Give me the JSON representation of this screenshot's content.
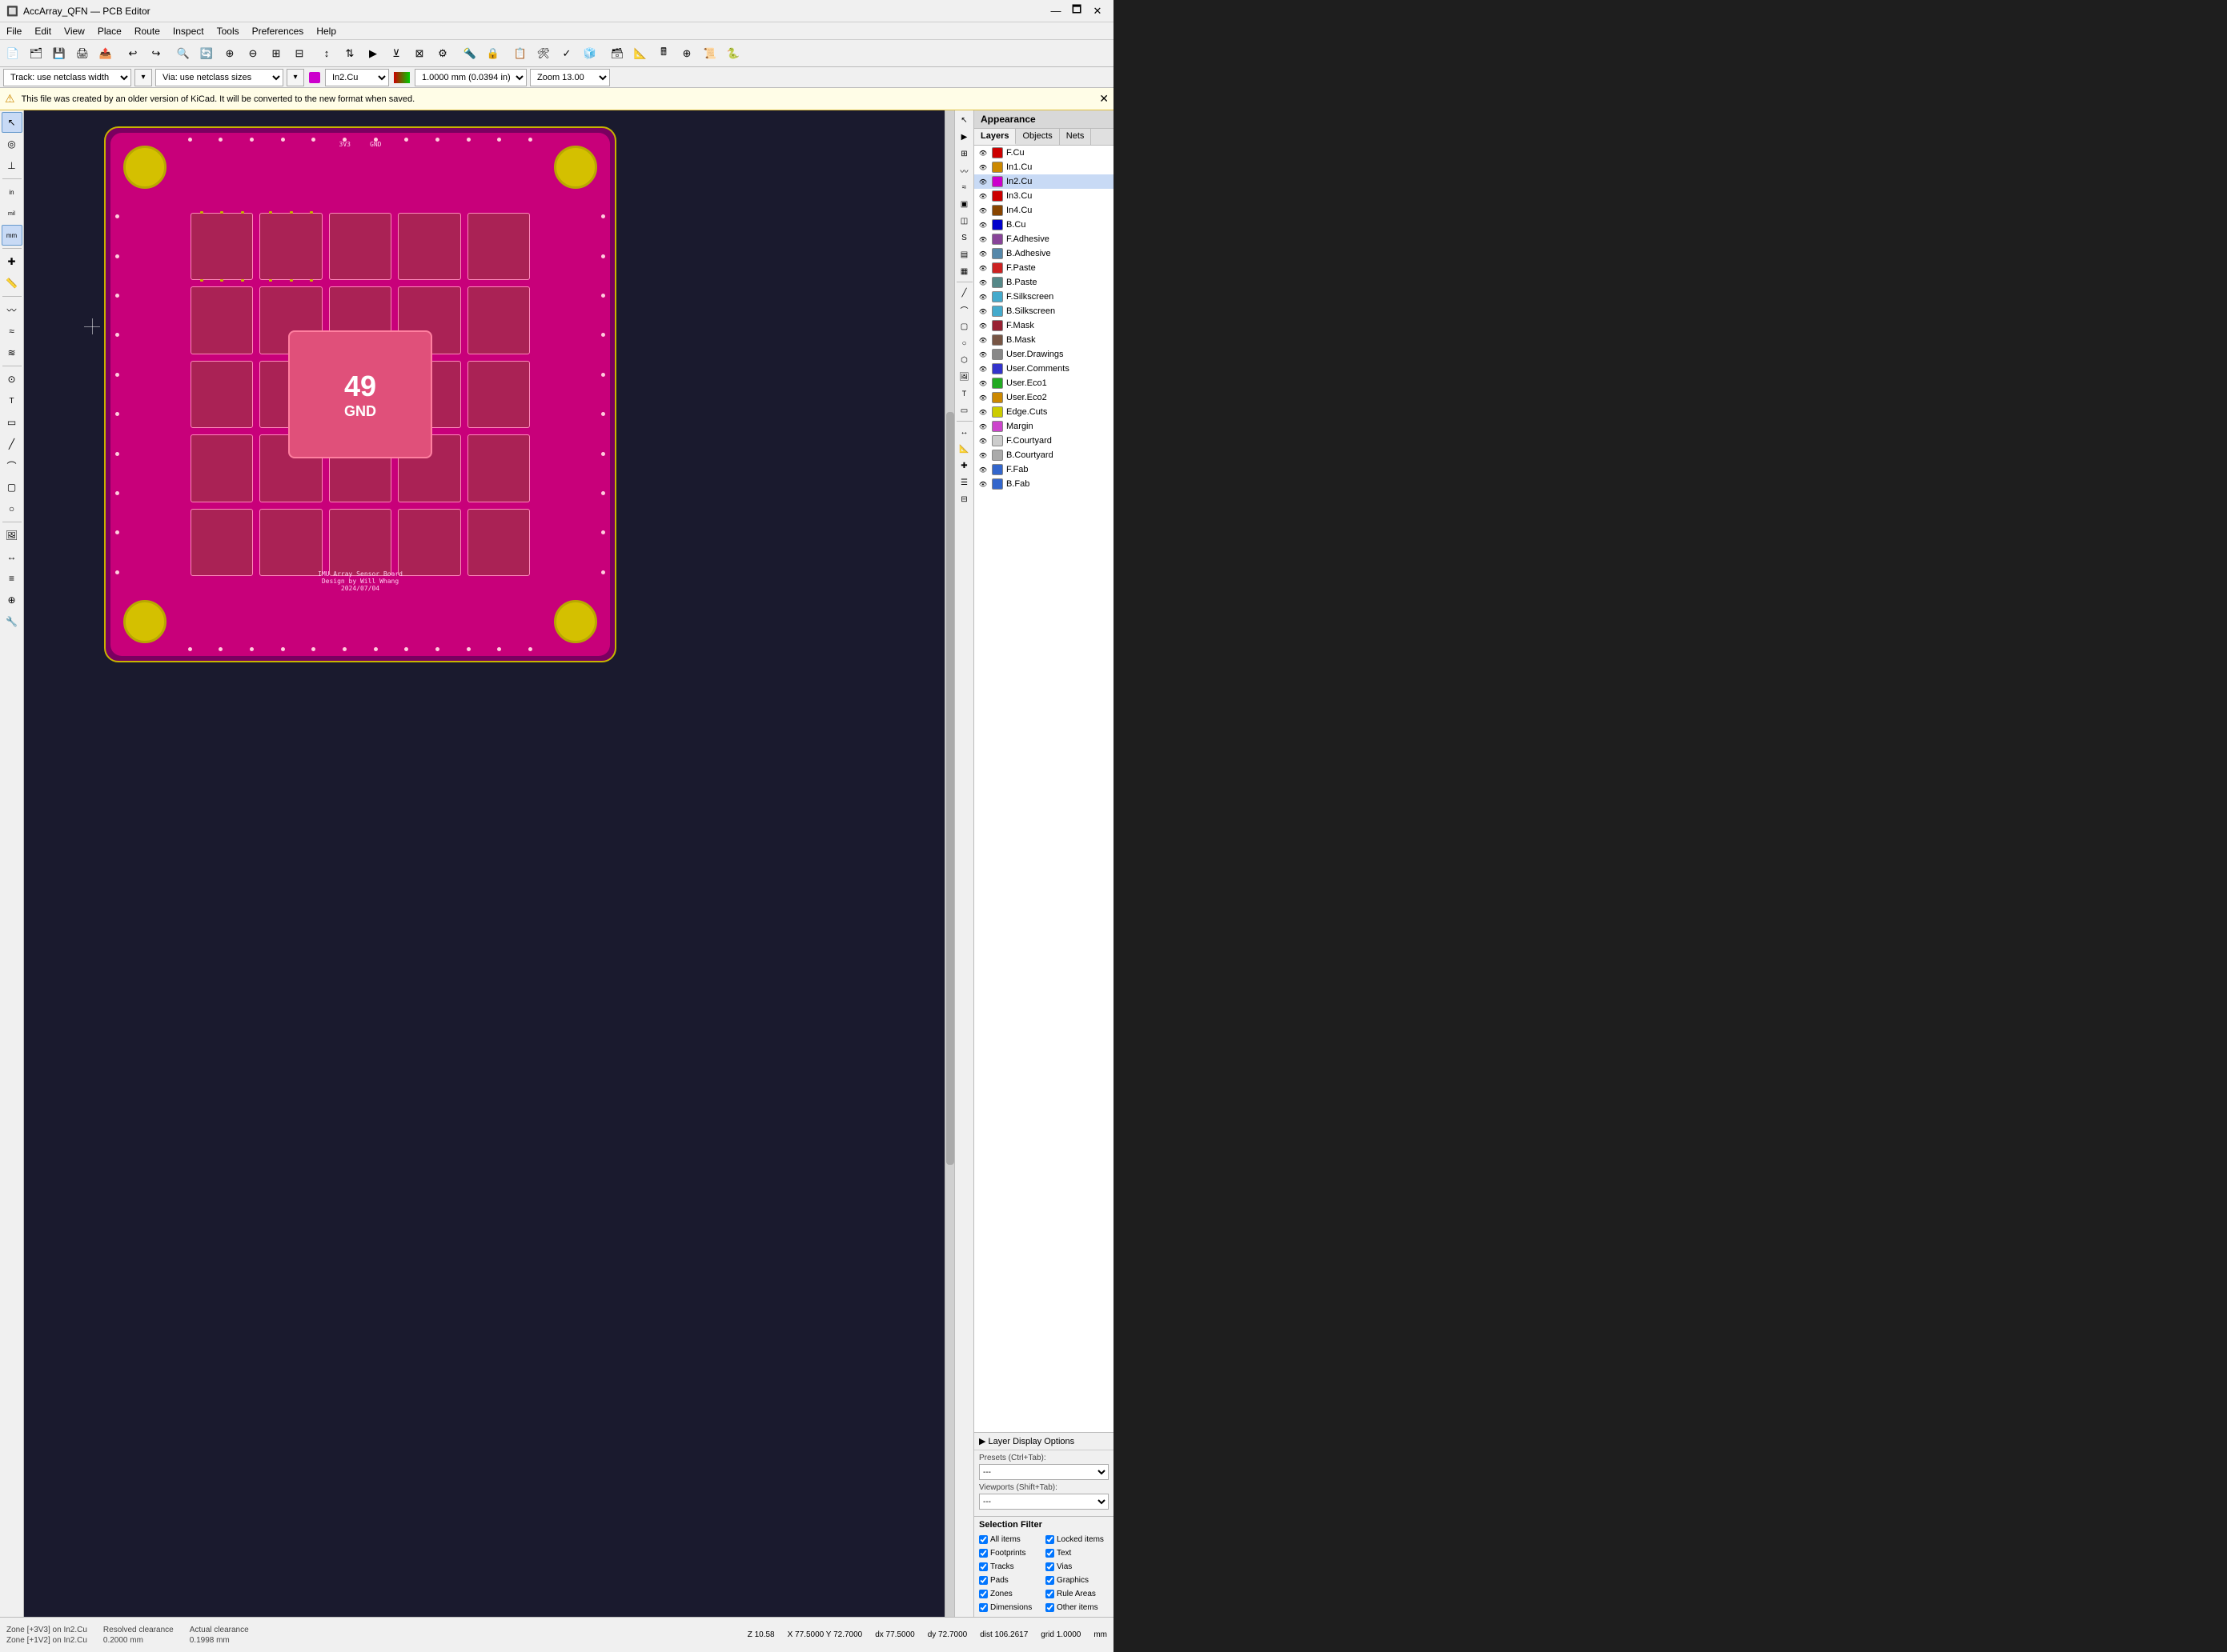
{
  "titlebar": {
    "title": "AccArray_QFN — PCB Editor",
    "icon": "🔲",
    "min_btn": "—",
    "max_btn": "🗖",
    "close_btn": "✕"
  },
  "menubar": {
    "items": [
      "File",
      "Edit",
      "View",
      "Place",
      "Route",
      "Inspect",
      "Tools",
      "Preferences",
      "Help"
    ]
  },
  "toolbar_main": {
    "buttons": [
      {
        "name": "new",
        "icon": "📄"
      },
      {
        "name": "open",
        "icon": "📁"
      },
      {
        "name": "save",
        "icon": "💾"
      },
      {
        "name": "print",
        "icon": "🖨"
      },
      {
        "name": "undo",
        "icon": "↩"
      },
      {
        "name": "redo",
        "icon": "↪"
      },
      {
        "name": "zoom-in",
        "icon": "🔍"
      },
      {
        "name": "zoom-out",
        "icon": "🔎"
      },
      {
        "name": "zoom-fit",
        "icon": "⊞"
      },
      {
        "name": "route",
        "icon": "〰"
      },
      {
        "name": "netlist",
        "icon": "📋"
      },
      {
        "name": "drc",
        "icon": "✓"
      },
      {
        "name": "3d",
        "icon": "🧊"
      }
    ]
  },
  "toolbar_second": {
    "track_label": "Track: use netclass width",
    "via_label": "Via: use netclass sizes",
    "layer_label": "In2.Cu",
    "width_label": "1.0000 mm (0.0394 in)",
    "zoom_label": "Zoom 13.00"
  },
  "infobar": {
    "message": "This file was created by an older version of KiCad. It will be converted to the new format when saved."
  },
  "left_toolbar": {
    "tools": [
      {
        "name": "select",
        "icon": "↖",
        "active": true
      },
      {
        "name": "highlight-net",
        "icon": "◎"
      },
      {
        "name": "local-ratsnest",
        "icon": "⊥"
      },
      {
        "name": "inch",
        "icon": "in"
      },
      {
        "name": "mil",
        "icon": "mi"
      },
      {
        "name": "mm",
        "icon": "mm"
      },
      {
        "name": "snap",
        "icon": "✚"
      },
      {
        "name": "measure",
        "icon": "📏"
      },
      {
        "name": "route-single",
        "icon": "〰"
      },
      {
        "name": "route-diff",
        "icon": "≈"
      },
      {
        "name": "fanout",
        "icon": "≋"
      },
      {
        "name": "add-via",
        "icon": "⊙"
      },
      {
        "name": "add-text",
        "icon": "T"
      },
      {
        "name": "add-zone",
        "icon": "▭"
      },
      {
        "name": "add-line",
        "icon": "╱"
      },
      {
        "name": "add-arc",
        "icon": "⌒"
      },
      {
        "name": "add-rect",
        "icon": "▢"
      },
      {
        "name": "add-circle",
        "icon": "○"
      },
      {
        "name": "add-poly",
        "icon": "⬡"
      },
      {
        "name": "add-image",
        "icon": "🖼"
      },
      {
        "name": "add-dim",
        "icon": "↔"
      },
      {
        "name": "scripting",
        "icon": "≡"
      },
      {
        "name": "pads",
        "icon": "⊕"
      },
      {
        "name": "delete",
        "icon": "✂"
      },
      {
        "name": "pcb-edit",
        "icon": "🔧"
      }
    ]
  },
  "right_toolbar": {
    "tools": [
      {
        "name": "cursor",
        "icon": "↖"
      },
      {
        "name": "push",
        "icon": "⊳"
      },
      {
        "name": "grid",
        "icon": "⊞"
      },
      {
        "name": "ratsnest",
        "icon": "~"
      },
      {
        "name": "copper",
        "icon": "≈"
      },
      {
        "name": "courtyard",
        "icon": "▣"
      },
      {
        "name": "fab",
        "icon": "◫"
      },
      {
        "name": "silk",
        "icon": "𝕊"
      },
      {
        "name": "mask",
        "icon": "▤"
      },
      {
        "name": "hatch",
        "icon": "▦"
      },
      {
        "name": "line",
        "icon": "╱"
      },
      {
        "name": "arc",
        "icon": "⌒"
      },
      {
        "name": "rect",
        "icon": "▢"
      },
      {
        "name": "circle",
        "icon": "○"
      },
      {
        "name": "poly",
        "icon": "⬡"
      },
      {
        "name": "image",
        "icon": "🖼"
      },
      {
        "name": "text",
        "icon": "T"
      },
      {
        "name": "textbox",
        "icon": "▭"
      },
      {
        "name": "dim",
        "icon": "↔"
      },
      {
        "name": "ruler",
        "icon": "📐"
      },
      {
        "name": "snap2",
        "icon": "✚"
      },
      {
        "name": "pad-list",
        "icon": "☰"
      },
      {
        "name": "grid-settings",
        "icon": "⊟"
      }
    ]
  },
  "appearance": {
    "title": "Appearance",
    "tabs": [
      "Layers",
      "Objects",
      "Nets"
    ],
    "active_tab": "Layers",
    "layers": [
      {
        "name": "F.Cu",
        "color": "#cc0000",
        "visible": true,
        "selected": false
      },
      {
        "name": "In1.Cu",
        "color": "#cc8800",
        "visible": true,
        "selected": false
      },
      {
        "name": "In2.Cu",
        "color": "#cc00cc",
        "visible": true,
        "selected": true
      },
      {
        "name": "In3.Cu",
        "color": "#cc0000",
        "visible": true,
        "selected": false
      },
      {
        "name": "In4.Cu",
        "color": "#884400",
        "visible": true,
        "selected": false
      },
      {
        "name": "B.Cu",
        "color": "#0000cc",
        "visible": true,
        "selected": false
      },
      {
        "name": "F.Adhesive",
        "color": "#884499",
        "visible": true,
        "selected": false
      },
      {
        "name": "B.Adhesive",
        "color": "#5588aa",
        "visible": true,
        "selected": false
      },
      {
        "name": "F.Paste",
        "color": "#cc2222",
        "visible": true,
        "selected": false
      },
      {
        "name": "B.Paste",
        "color": "#558888",
        "visible": true,
        "selected": false
      },
      {
        "name": "F.Silkscreen",
        "color": "#44aacc",
        "visible": true,
        "selected": false
      },
      {
        "name": "B.Silkscreen",
        "color": "#44aacc",
        "visible": true,
        "selected": false
      },
      {
        "name": "F.Mask",
        "color": "#992233",
        "visible": true,
        "selected": false
      },
      {
        "name": "B.Mask",
        "color": "#775544",
        "visible": true,
        "selected": false
      },
      {
        "name": "User.Drawings",
        "color": "#888888",
        "visible": true,
        "selected": false
      },
      {
        "name": "User.Comments",
        "color": "#3333cc",
        "visible": true,
        "selected": false
      },
      {
        "name": "User.Eco1",
        "color": "#22aa22",
        "visible": true,
        "selected": false
      },
      {
        "name": "User.Eco2",
        "color": "#cc8800",
        "visible": true,
        "selected": false
      },
      {
        "name": "Edge.Cuts",
        "color": "#cccc00",
        "visible": true,
        "selected": false
      },
      {
        "name": "Margin",
        "color": "#cc44cc",
        "visible": true,
        "selected": false
      },
      {
        "name": "F.Courtyard",
        "color": "#cccccc",
        "visible": true,
        "selected": false
      },
      {
        "name": "B.Courtyard",
        "color": "#aaaaaa",
        "visible": true,
        "selected": false
      },
      {
        "name": "F.Fab",
        "color": "#3366cc",
        "visible": true,
        "selected": false
      },
      {
        "name": "B.Fab",
        "color": "#3366cc",
        "visible": true,
        "selected": false
      }
    ],
    "layer_display_opts": "▶ Layer Display Options",
    "presets_label": "Presets (Ctrl+Tab):",
    "presets_value": "---",
    "viewports_label": "Viewports (Shift+Tab):",
    "viewports_value": "---"
  },
  "selection_filter": {
    "title": "Selection Filter",
    "items": [
      {
        "name": "All items",
        "checked": true
      },
      {
        "name": "Locked items",
        "checked": true
      },
      {
        "name": "Footprints",
        "checked": true
      },
      {
        "name": "Text",
        "checked": true
      },
      {
        "name": "Tracks",
        "checked": true
      },
      {
        "name": "Vias",
        "checked": true
      },
      {
        "name": "Pads",
        "checked": true
      },
      {
        "name": "Graphics",
        "checked": true
      },
      {
        "name": "Zones",
        "checked": true
      },
      {
        "name": "Rule Areas",
        "checked": true
      },
      {
        "name": "Dimensions",
        "checked": true
      },
      {
        "name": "Other items",
        "checked": true
      }
    ]
  },
  "statusbar": {
    "zone_line1": "Zone [+3V3] on In2.Cu",
    "zone_line2": "Zone [+1V2] on In2.Cu",
    "clearance_label": "Resolved clearance",
    "clearance_value": "0.2000 mm",
    "actual_label": "Actual clearance",
    "actual_value": "0.1998 mm"
  },
  "coordbar": {
    "z": "Z 10.58",
    "xy": "X 77.5000 Y 72.7000",
    "dx": "dx 77.5000",
    "dy": "dy 72.7000",
    "dist": "dist 106.2617",
    "grid": "grid 1.0000",
    "unit": "mm"
  },
  "pcb": {
    "center_number": "49",
    "center_label": "GND",
    "silk_lines": [
      "IMU Array Sensor Board",
      "Design by Will Whang",
      "2024/07/04"
    ]
  }
}
